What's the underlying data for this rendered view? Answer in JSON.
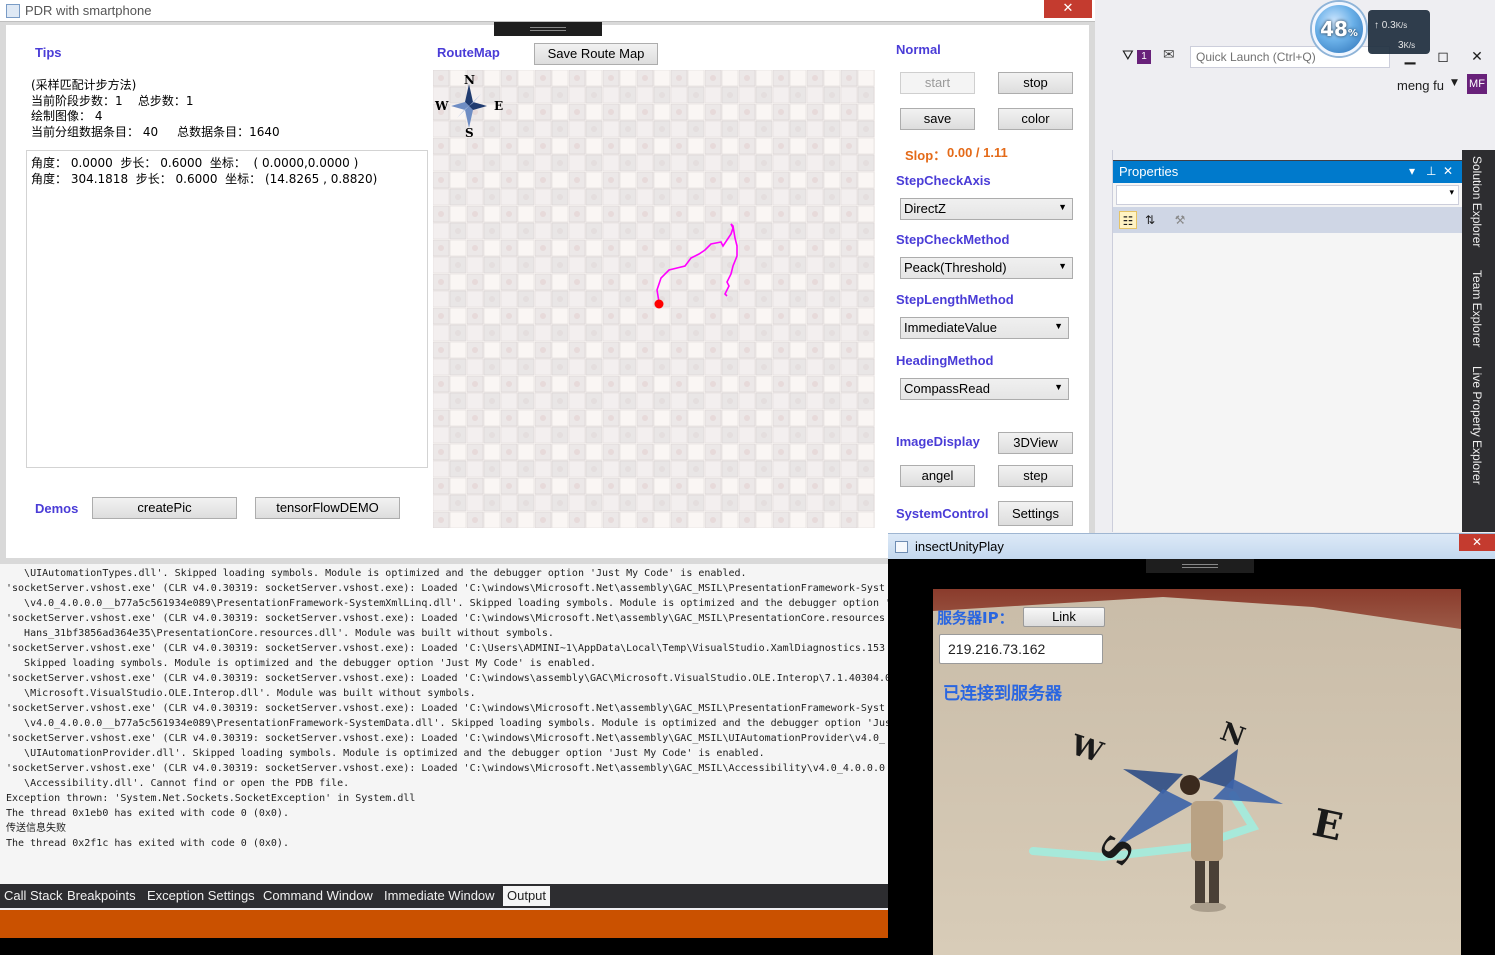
{
  "vs": {
    "quick_launch_placeholder": "Quick Launch (Ctrl+Q)",
    "filter_badge": "1",
    "user_name": "meng fu",
    "user_initials": "MF",
    "net_monitor": {
      "percent": "48",
      "percent_unit": "%",
      "upload": "0.3",
      "upload_unit": "K/s",
      "download": "3",
      "download_unit": "K/s"
    },
    "properties": {
      "title": "Properties"
    },
    "side_tabs": [
      "Solution Explorer",
      "Team Explorer",
      "Live Property Explorer"
    ],
    "output_lines": [
      "   \\UIAutomationTypes.dll'. Skipped loading symbols. Module is optimized and the debugger option 'Just My Code' is enabled.",
      "'socketServer.vshost.exe' (CLR v4.0.30319: socketServer.vshost.exe): Loaded 'C:\\windows\\Microsoft.Net\\assembly\\GAC_MSIL\\PresentationFramework-Syst",
      "   \\v4.0_4.0.0.0__b77a5c561934e089\\PresentationFramework-SystemXmlLinq.dll'. Skipped loading symbols. Module is optimized and the debugger option 'J",
      "'socketServer.vshost.exe' (CLR v4.0.30319: socketServer.vshost.exe): Loaded 'C:\\windows\\Microsoft.Net\\assembly\\GAC_MSIL\\PresentationCore.resources",
      "   Hans_31bf3856ad364e35\\PresentationCore.resources.dll'. Module was built without symbols.",
      "'socketServer.vshost.exe' (CLR v4.0.30319: socketServer.vshost.exe): Loaded 'C:\\Users\\ADMINI~1\\AppData\\Local\\Temp\\VisualStudio.XamlDiagnostics.153",
      "   Skipped loading symbols. Module is optimized and the debugger option 'Just My Code' is enabled.",
      "'socketServer.vshost.exe' (CLR v4.0.30319: socketServer.vshost.exe): Loaded 'C:\\windows\\assembly\\GAC\\Microsoft.VisualStudio.OLE.Interop\\7.1.40304.0",
      "   \\Microsoft.VisualStudio.OLE.Interop.dll'. Module was built without symbols.",
      "'socketServer.vshost.exe' (CLR v4.0.30319: socketServer.vshost.exe): Loaded 'C:\\windows\\Microsoft.Net\\assembly\\GAC_MSIL\\PresentationFramework-Syst",
      "   \\v4.0_4.0.0.0__b77a5c561934e089\\PresentationFramework-SystemData.dll'. Skipped loading symbols. Module is optimized and the debugger option 'Jus",
      "'socketServer.vshost.exe' (CLR v4.0.30319: socketServer.vshost.exe): Loaded 'C:\\windows\\Microsoft.Net\\assembly\\GAC_MSIL\\UIAutomationProvider\\v4.0_",
      "   \\UIAutomationProvider.dll'. Skipped loading symbols. Module is optimized and the debugger option 'Just My Code' is enabled.",
      "'socketServer.vshost.exe' (CLR v4.0.30319: socketServer.vshost.exe): Loaded 'C:\\windows\\Microsoft.Net\\assembly\\GAC_MSIL\\Accessibility\\v4.0_4.0.0.0",
      "   \\Accessibility.dll'. Cannot find or open the PDB file.",
      "Exception thrown: 'System.Net.Sockets.SocketException' in System.dll",
      "The thread 0x1eb0 has exited with code 0 (0x0).",
      "传送信息失败",
      "The thread 0x2f1c has exited with code 0 (0x0)."
    ],
    "bottom_tabs": [
      "Call Stack",
      "Breakpoints",
      "Exception Settings",
      "Command Window",
      "Immediate Window",
      "Output"
    ],
    "active_tab": "Output"
  },
  "pdr": {
    "title": "PDR  with smartphone",
    "close_glyph": "✕",
    "tips_label": "Tips",
    "tips_lines": [
      "(采样匹配计步方法)",
      "当前阶段步数：1    总步数：1",
      "绘制图像： 4",
      "当前分组数据条目： 40     总数据条目：1640"
    ],
    "log_lines": [
      "角度： 0.0000  步长： 0.6000  坐标：  ( 0.0000,0.0000 )",
      "角度： 304.1818  步长： 0.6000  坐标： (14.8265 , 0.8820)"
    ],
    "demos_label": "Demos",
    "create_pic": "createPic",
    "tensorflow_demo": "tensorFlowDEMO",
    "routemap_label": "RouteMap",
    "save_route_map": "Save Route Map",
    "compass": {
      "n": "N",
      "s": "S",
      "w": "W",
      "e": "E"
    },
    "normal_label": "Normal",
    "start": "start",
    "stop": "stop",
    "save": "save",
    "color": "color",
    "slop_label": "Slop：",
    "slop_value": "0.00 / 1.11",
    "step_check_axis_label": "StepCheckAxis",
    "step_check_axis_value": "DirectZ",
    "step_check_method_label": "StepCheckMethod",
    "step_check_method_value": "Peack(Threshold)",
    "step_length_method_label": "StepLengthMethod",
    "step_length_method_value": "ImmediateValue",
    "heading_method_label": "HeadingMethod",
    "heading_method_value": "CompassRead",
    "image_display_label": "ImageDisplay",
    "view3d": "3DView",
    "angel": "angel",
    "step": "step",
    "system_control_label": "SystemControl",
    "settings": "Settings",
    "route_color": "#ff00ff",
    "start_dot_color": "#ff0000"
  },
  "unity": {
    "title": "insectUnityPlay",
    "close_glyph": "✕",
    "server_ip_label": "服务器IP：",
    "link_button": "Link",
    "ip_value": "219.216.73.162",
    "status": "已连接到服务器",
    "compass": {
      "n": "N",
      "s": "S",
      "w": "W",
      "e": "E"
    }
  }
}
